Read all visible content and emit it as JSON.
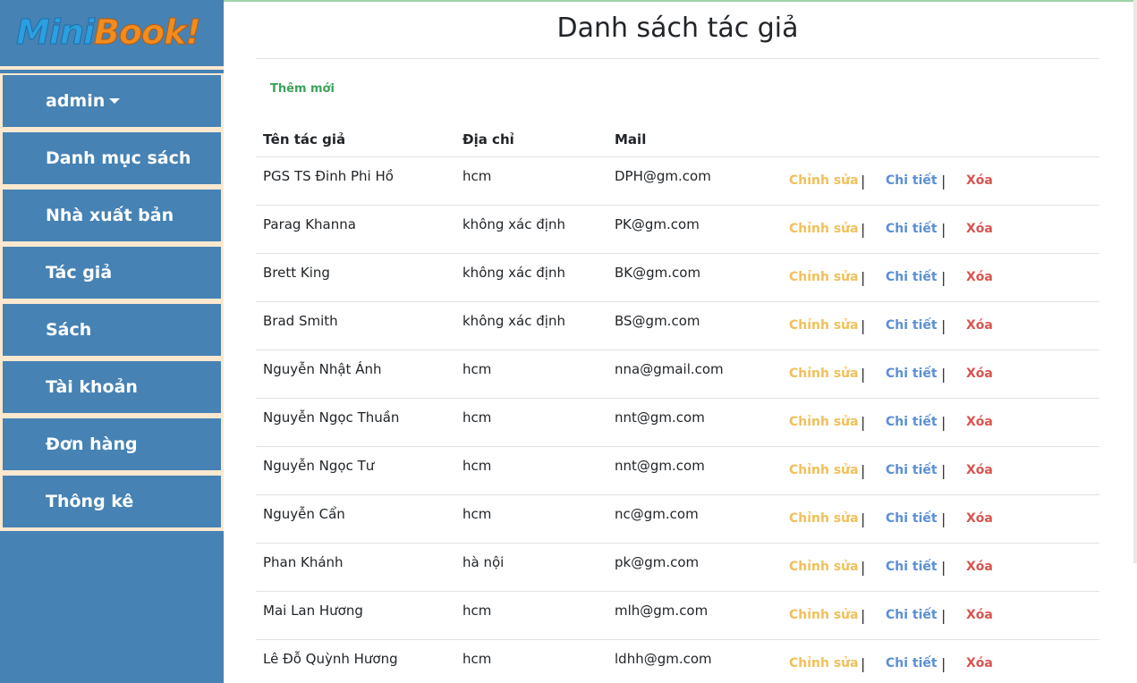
{
  "brand": {
    "part1": "Mini",
    "part2": "Book!"
  },
  "sidebar": {
    "items": [
      {
        "label": "admin",
        "has_caret": true
      },
      {
        "label": "Danh mục sách"
      },
      {
        "label": "Nhà xuất bản"
      },
      {
        "label": "Tác giả"
      },
      {
        "label": "Sách"
      },
      {
        "label": "Tài khoản"
      },
      {
        "label": "Đơn hàng"
      },
      {
        "label": "Thông kê"
      }
    ]
  },
  "page": {
    "title": "Danh sách tác giả",
    "add_label": "Thêm mới"
  },
  "table": {
    "headers": {
      "name": "Tên tác giả",
      "address": "Địa chỉ",
      "mail": "Mail"
    },
    "actions": {
      "edit": "Chỉnh sửa",
      "detail": "Chi tiết",
      "delete": "Xóa",
      "separator": "|"
    },
    "rows": [
      {
        "name": "PGS TS Đinh Phi Hồ",
        "address": "hcm",
        "mail": "DPH@gm.com"
      },
      {
        "name": "Parag Khanna",
        "address": "không xác định",
        "mail": "PK@gm.com"
      },
      {
        "name": "Brett King",
        "address": "không xác định",
        "mail": "BK@gm.com"
      },
      {
        "name": "Brad Smith",
        "address": "không xác định",
        "mail": "BS@gm.com"
      },
      {
        "name": "Nguyễn Nhật Ánh",
        "address": "hcm",
        "mail": "nna@gmail.com"
      },
      {
        "name": "Nguyễn Ngọc Thuần",
        "address": "hcm",
        "mail": "nnt@gm.com"
      },
      {
        "name": "Nguyễn Ngọc Tư",
        "address": "hcm",
        "mail": "nnt@gm.com"
      },
      {
        "name": "Nguyễn Cẩn",
        "address": "hcm",
        "mail": "nc@gm.com"
      },
      {
        "name": "Phan Khánh",
        "address": "hà nội",
        "mail": "pk@gm.com"
      },
      {
        "name": "Mai Lan Hương",
        "address": "hcm",
        "mail": "mlh@gm.com"
      },
      {
        "name": "Lê Đỗ Quỳnh Hương",
        "address": "hcm",
        "mail": "ldhh@gm.com"
      }
    ]
  },
  "colors": {
    "sidebar_bg": "#4682b4",
    "sidebar_border": "#fbe8cf",
    "add_link": "#3aa35a",
    "edit": "#f0c05a",
    "detail": "#5b8fd6",
    "delete": "#d9534f"
  }
}
